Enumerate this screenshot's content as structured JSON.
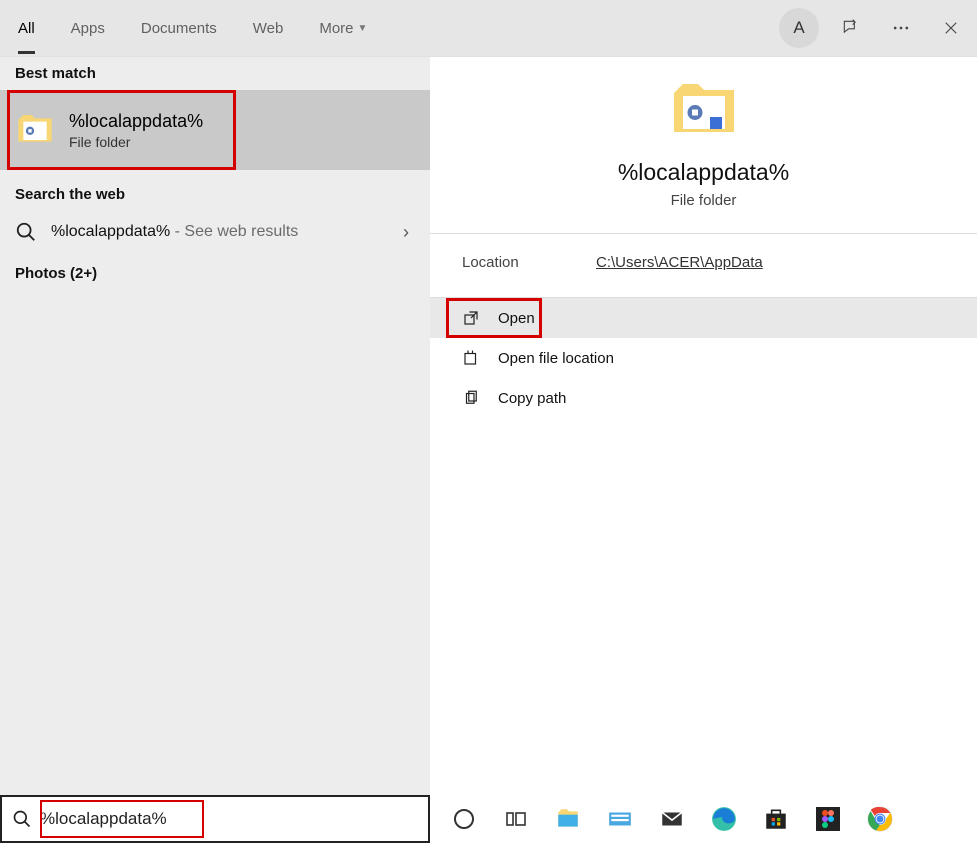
{
  "tabs": {
    "all": "All",
    "apps": "Apps",
    "documents": "Documents",
    "web": "Web",
    "more": "More"
  },
  "avatar_initial": "A",
  "left": {
    "best_match_header": "Best match",
    "best_match_title": "%localappdata%",
    "best_match_subtitle": "File folder",
    "search_web_header": "Search the web",
    "web_query": "%localappdata%",
    "web_suffix": " - See web results",
    "photos_header": "Photos (2+)"
  },
  "preview": {
    "title": "%localappdata%",
    "subtitle": "File folder",
    "location_label": "Location",
    "location_path": "C:\\Users\\ACER\\AppData"
  },
  "actions": {
    "open": "Open",
    "open_file_location": "Open file location",
    "copy_path": "Copy path"
  },
  "search": {
    "value": "%localappdata%"
  }
}
